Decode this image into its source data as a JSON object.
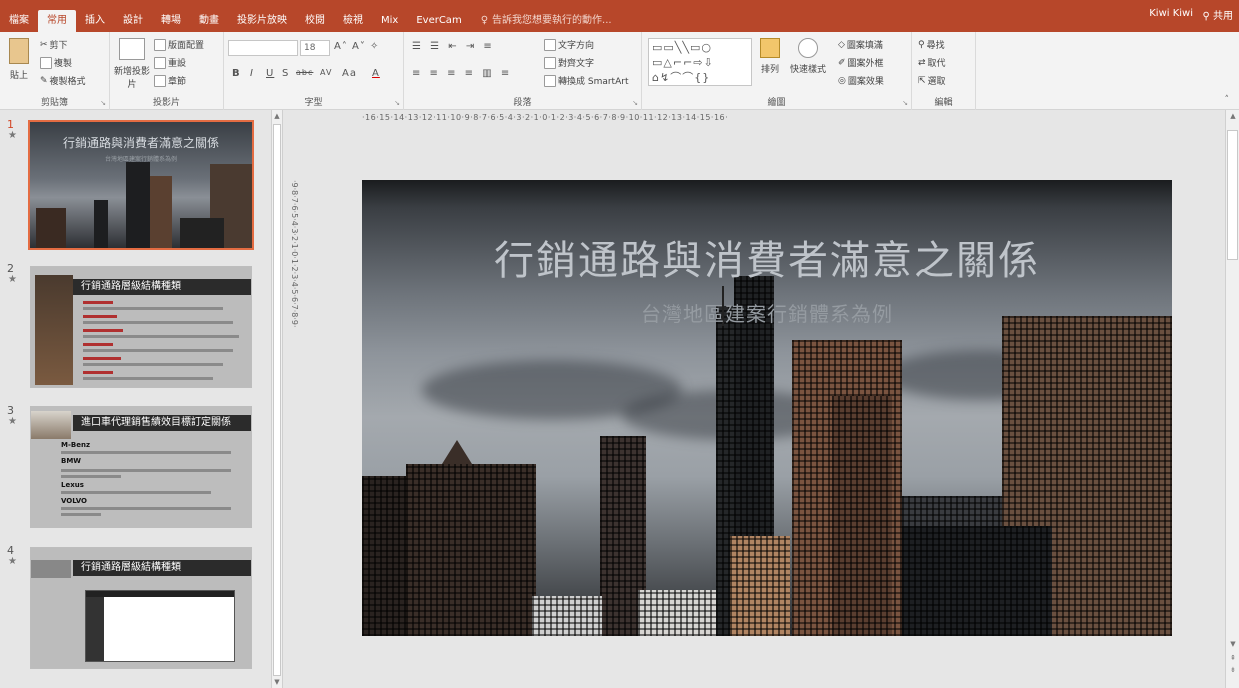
{
  "tabs": [
    "檔案",
    "常用",
    "插入",
    "設計",
    "轉場",
    "動畫",
    "投影片放映",
    "校閱",
    "檢視",
    "Mix",
    "EverCam"
  ],
  "active_tab": "常用",
  "tell_me": "告訴我您想要執行的動作...",
  "user_name": "Kiwi Kiwi",
  "share_label": "共用",
  "ribbon": {
    "clipboard": {
      "title": "剪貼簿",
      "paste": "貼上",
      "cut": "剪下",
      "copy": "複製",
      "format_painter": "複製格式"
    },
    "slides": {
      "title": "投影片",
      "new_slide": "新增投影片",
      "layout": "版面配置",
      "reset": "重設",
      "section": "章節"
    },
    "font": {
      "title": "字型",
      "size": "18",
      "bold": "B",
      "italic": "I",
      "underline": "U",
      "shadow": "S",
      "strike": "abc",
      "spacing": "AV",
      "case": "Aa",
      "color": "A"
    },
    "paragraph": {
      "title": "段落",
      "text_direction": "文字方向",
      "align_text": "對齊文字",
      "smartart": "轉換成 SmartArt"
    },
    "drawing": {
      "title": "繪圖",
      "arrange": "排列",
      "quick_styles": "快速樣式",
      "shape_fill": "圖案填滿",
      "shape_outline": "圖案外框",
      "shape_effects": "圖案效果"
    },
    "editing": {
      "title": "編輯",
      "find": "尋找",
      "replace": "取代",
      "select": "選取"
    }
  },
  "slides_panel": [
    {
      "num": "1",
      "title": "行銷通路與消費者滿意之關係",
      "subtitle": "台灣地區建案行銷體系為例",
      "selected": true
    },
    {
      "num": "2",
      "title": "行銷通路層級結構種類"
    },
    {
      "num": "3",
      "title": "進口車代理銷售績效目標訂定關係",
      "brands": [
        "M-Benz",
        "BMW",
        "Lexus",
        "VOLVO"
      ]
    },
    {
      "num": "4",
      "title": "行銷通路層級結構種類"
    }
  ],
  "star": "★",
  "slide": {
    "title": "行銷通路與消費者滿意之關係",
    "subtitle": "台灣地區建案行銷體系為例"
  },
  "rulers": {
    "horizontal": "·16·15·14·13·12·11·10·9·8·7·6·5·4·3·2·1·0·1·2·3·4·5·6·7·8·9·10·11·12·13·14·15·16·",
    "vertical": "·9·8·7·6·5·4·3·2·1·0·1·2·3·4·5·6·7·8·9·"
  }
}
